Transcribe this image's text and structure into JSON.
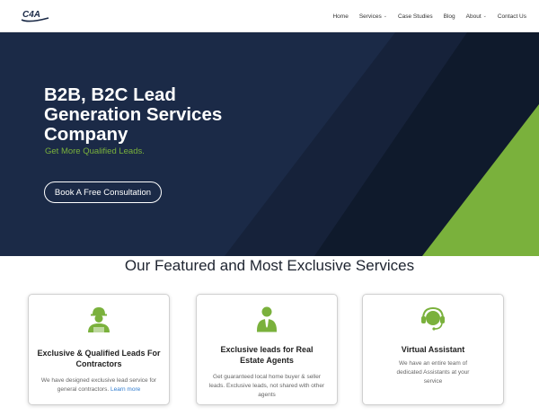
{
  "header": {
    "logo_text": "C4A",
    "nav": [
      {
        "label": "Home",
        "has_dropdown": false
      },
      {
        "label": "Services",
        "has_dropdown": true
      },
      {
        "label": "Case Studies",
        "has_dropdown": false
      },
      {
        "label": "Blog",
        "has_dropdown": false
      },
      {
        "label": "About",
        "has_dropdown": true
      },
      {
        "label": "Contact Us",
        "has_dropdown": false
      }
    ]
  },
  "hero": {
    "title": "B2B, B2C Lead Generation Services Company",
    "subtitle": "Get More Qualified Leads.",
    "cta_label": "Book A Free Consultation"
  },
  "services": {
    "heading": "Our Featured and Most Exclusive Services",
    "cards": [
      {
        "icon": "contractor-icon",
        "title": "Exclusive & Qualified Leads For Contractors",
        "text": "We have designed exclusive lead service for general contractors.",
        "link": "Learn more"
      },
      {
        "icon": "agent-icon",
        "title": "Exclusive leads for Real Estate Agents",
        "text": "Get guaranteed local home buyer & seller leads. Exclusive leads, not shared with other agents",
        "link": ""
      },
      {
        "icon": "headset-icon",
        "title": "Virtual Assistant",
        "text": "We have an entire team of dedicated Assistants at your service",
        "link": ""
      }
    ]
  },
  "colors": {
    "hero_bg": "#1b2a47",
    "hero_dark": "#0f1a2c",
    "accent_green": "#7ab13c",
    "link_blue": "#2e7bcf"
  }
}
